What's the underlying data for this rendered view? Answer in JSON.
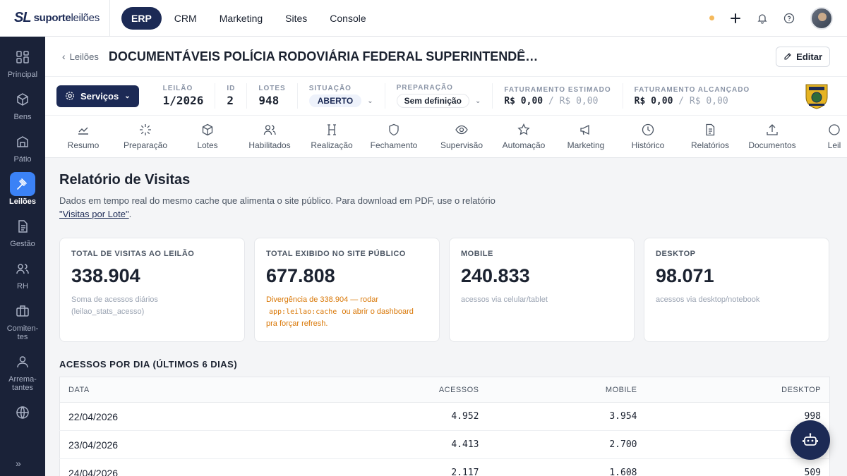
{
  "brand": {
    "mark": "SL",
    "name_bold": "suporte",
    "name_light": "leilões"
  },
  "topnav": [
    {
      "label": "ERP",
      "active": true
    },
    {
      "label": "CRM"
    },
    {
      "label": "Marketing"
    },
    {
      "label": "Sites"
    },
    {
      "label": "Console"
    }
  ],
  "sidebar": [
    {
      "label": "Principal",
      "icon": "grid-icon"
    },
    {
      "label": "Bens",
      "icon": "box-icon"
    },
    {
      "label": "Pátio",
      "icon": "warehouse-icon"
    },
    {
      "label": "Leilões",
      "icon": "gavel-icon",
      "active": true
    },
    {
      "label": "Gestão",
      "icon": "document-icon"
    },
    {
      "label": "RH",
      "icon": "people-icon"
    },
    {
      "label": "Comiten-tes",
      "icon": "briefcase-icon"
    },
    {
      "label": "Arrema-tantes",
      "icon": "person-icon"
    },
    {
      "label": "",
      "icon": "globe-icon"
    }
  ],
  "header": {
    "back_label": "Leilões",
    "title": "DOCUMENTÁVEIS POLÍCIA RODOVIÁRIA FEDERAL SUPERINTENDÊNCI...",
    "edit_label": "Editar"
  },
  "info": {
    "services_label": "Serviços",
    "leilao_label": "LEILÃO",
    "leilao_value": "1/2026",
    "id_label": "ID",
    "id_value": "2",
    "lotes_label": "LOTES",
    "lotes_value": "948",
    "situacao_label": "SITUAÇÃO",
    "situacao_value": "ABERTO",
    "preparacao_label": "PREPARAÇÃO",
    "preparacao_value": "Sem definição",
    "fat_est_label": "FATURAMENTO ESTIMADO",
    "fat_est_value": "R$ 0,00",
    "fat_est_of": "/ R$ 0,00",
    "fat_alc_label": "FATURAMENTO ALCANÇADO",
    "fat_alc_value": "R$ 0,00",
    "fat_alc_of": "/ R$ 0,00"
  },
  "tabs": [
    "Resumo",
    "Preparação",
    "Lotes",
    "Habilitados",
    "Realização",
    "Fechamento",
    "Supervisão",
    "Automação",
    "Marketing",
    "Histórico",
    "Relatórios",
    "Documentos",
    "Leil"
  ],
  "page": {
    "title": "Relatório de Visitas",
    "subtitle": "Dados em tempo real do mesmo cache que alimenta o site público. Para download em PDF, use o relatório",
    "subtitle_link": "\"Visitas por Lote\"",
    "subtitle_end": "."
  },
  "cards": [
    {
      "label": "TOTAL DE VISITAS AO LEILÃO",
      "value": "338.904",
      "note1": "Soma de acessos diários",
      "note2": "(leilao_stats_acesso)"
    },
    {
      "label": "TOTAL EXIBIDO NO SITE PÚBLICO",
      "value": "677.808",
      "warn_a": "Divergência de 338.904 — rodar",
      "warn_code": "app:leilao:cache",
      "warn_b": "ou abrir o dashboard",
      "warn_c": "pra forçar refresh."
    },
    {
      "label": "MOBILE",
      "value": "240.833",
      "note1": "acessos via celular/tablet"
    },
    {
      "label": "DESKTOP",
      "value": "98.071",
      "note1": "acessos via desktop/notebook"
    }
  ],
  "daily": {
    "title": "ACESSOS POR DIA (ÚLTIMOS 6 DIAS)",
    "headers": [
      "DATA",
      "ACESSOS",
      "MOBILE",
      "DESKTOP"
    ],
    "rows": [
      [
        "22/04/2026",
        "4.952",
        "3.954",
        "998"
      ],
      [
        "23/04/2026",
        "4.413",
        "2.700",
        ""
      ],
      [
        "24/04/2026",
        "2.117",
        "1.608",
        "509"
      ]
    ]
  }
}
